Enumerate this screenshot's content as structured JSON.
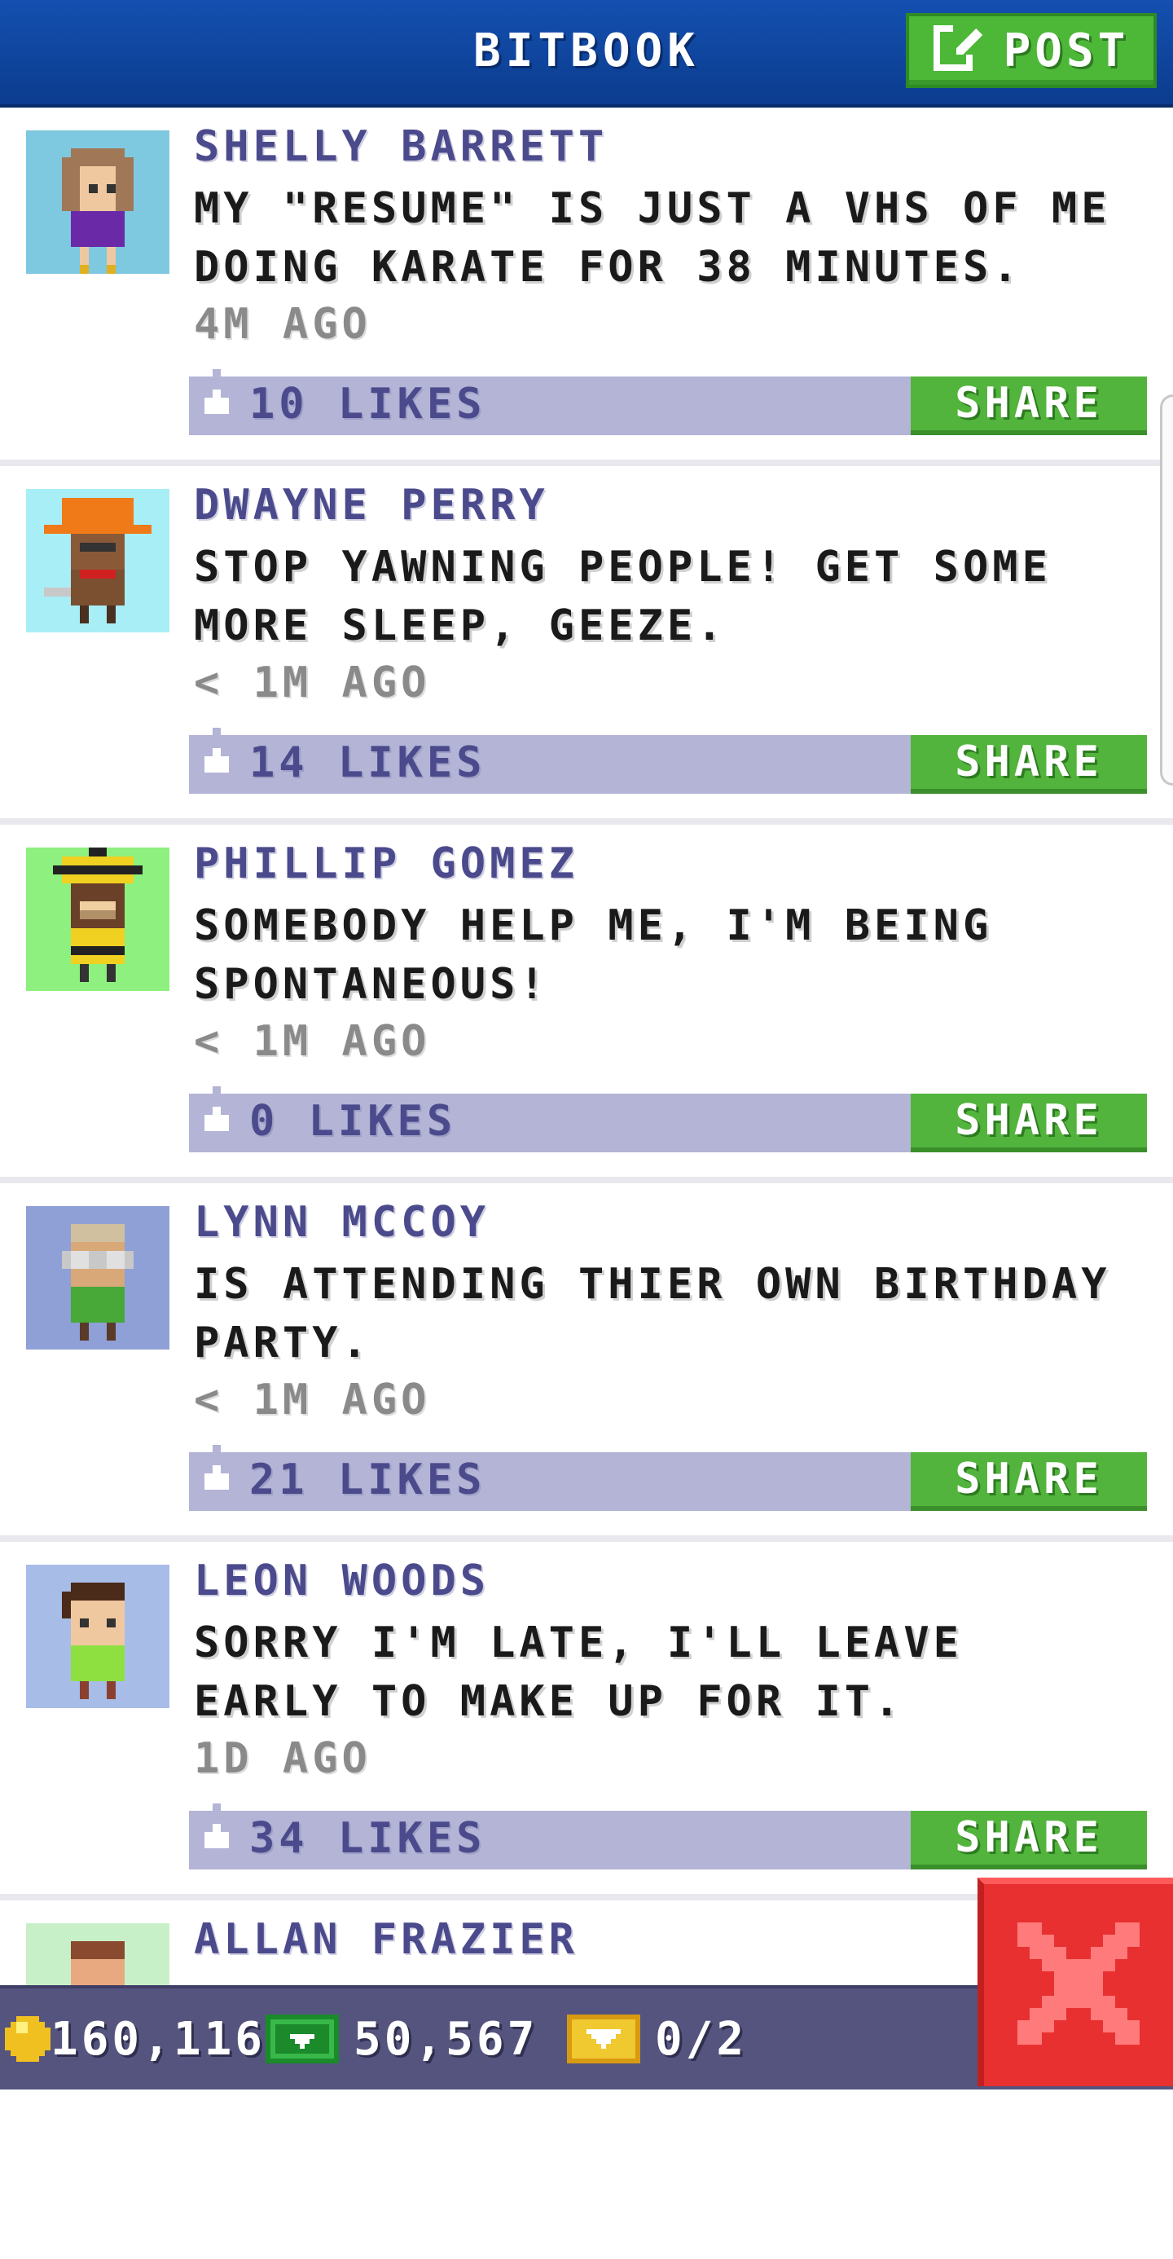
{
  "header": {
    "title": "BITBOOK",
    "post_label": "POST"
  },
  "posts": [
    {
      "author": "SHELLY BARRETT",
      "message": "MY \"RESUME\" IS JUST A VHS OF ME DOING KARATE FOR 38 MINUTES.",
      "time": "4M AGO",
      "likes": "10 LIKES",
      "share": "SHARE",
      "avatar_bg": "#7ec8e0"
    },
    {
      "author": "DWAYNE PERRY",
      "message": "STOP YAWNING PEOPLE! GET SOME MORE SLEEP, GEEZE.",
      "time": "< 1M AGO",
      "likes": "14 LIKES",
      "share": "SHARE",
      "avatar_bg": "#a8eef6"
    },
    {
      "author": "PHILLIP GOMEZ",
      "message": "SOMEBODY HELP ME, I'M BEING SPONTANEOUS!",
      "time": "< 1M AGO",
      "likes": "0 LIKES",
      "share": "SHARE",
      "avatar_bg": "#8ef07e"
    },
    {
      "author": "LYNN MCCOY",
      "message": "IS ATTENDING THIER OWN BIRTHDAY PARTY.",
      "time": "< 1M AGO",
      "likes": "21 LIKES",
      "share": "SHARE",
      "avatar_bg": "#8ea0d6"
    },
    {
      "author": "LEON WOODS",
      "message": "SORRY I'M LATE, I'LL LEAVE EARLY TO MAKE UP FOR IT.",
      "time": "1D AGO",
      "likes": "34 LIKES",
      "share": "SHARE",
      "avatar_bg": "#a8bce8"
    },
    {
      "author": "ALLAN FRAZIER",
      "message": "",
      "time": "",
      "likes": "",
      "share": "",
      "avatar_bg": "#c8f0c8"
    }
  ],
  "status": {
    "coins": "160,116",
    "bux": "50,567",
    "tickets": "0/2"
  },
  "icons": {
    "post": "edit-icon",
    "like": "thumbs-up-icon",
    "coin": "coin-icon",
    "bux": "bux-icon",
    "ticket": "golden-ticket-icon",
    "close": "close-icon"
  },
  "colors": {
    "header": "#1450b0",
    "green": "#4db838",
    "like_bar": "#b3b4d6",
    "author": "#4b4a8c",
    "close": "#e83030"
  }
}
